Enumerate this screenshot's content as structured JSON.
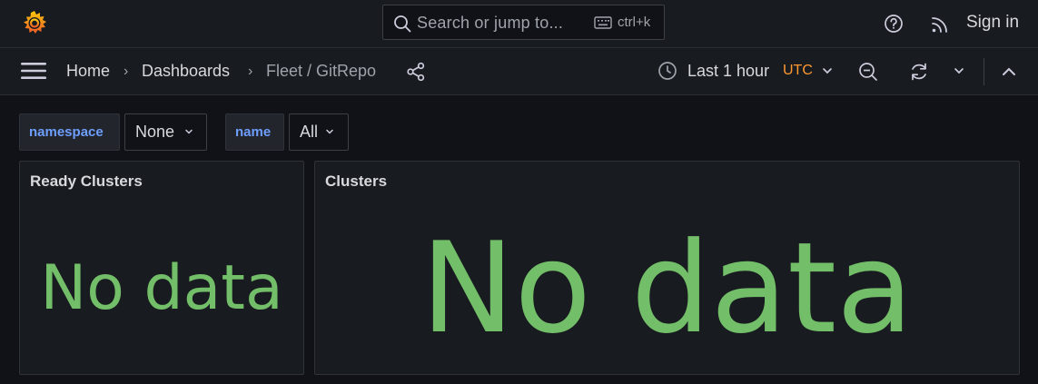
{
  "topbar": {
    "logo_icon": "grafana-logo-icon",
    "search": {
      "placeholder": "Search or jump to...",
      "shortcut": "ctrl+k",
      "icon": "search-icon",
      "keyboard_icon": "keyboard-icon"
    },
    "help_icon": "help-icon",
    "news_icon": "rss-icon",
    "sign_in": "Sign in"
  },
  "navbar": {
    "menu_icon": "menu-icon",
    "breadcrumbs": [
      "Home",
      "Dashboards",
      "Fleet / GitRepo"
    ],
    "breadcrumb_separator": "›",
    "share_icon": "share-icon",
    "time_picker": {
      "label": "Last 1 hour",
      "timezone": "UTC",
      "icon": "clock-icon"
    },
    "zoom_out_icon": "zoom-out-icon",
    "refresh_icon": "refresh-icon",
    "collapse_icon": "chevron-up-icon"
  },
  "variables": [
    {
      "label": "namespace",
      "value": "None"
    },
    {
      "label": "name",
      "value": "All"
    }
  ],
  "panels": [
    {
      "title": "Ready Clusters",
      "value": "No data"
    },
    {
      "title": "Clusters",
      "value": "No data"
    }
  ],
  "colors": {
    "background": "#111217",
    "bar": "#181b1f",
    "no_data": "#73bf69",
    "utc": "#ff9830",
    "variable_label": "#6e9fff"
  }
}
